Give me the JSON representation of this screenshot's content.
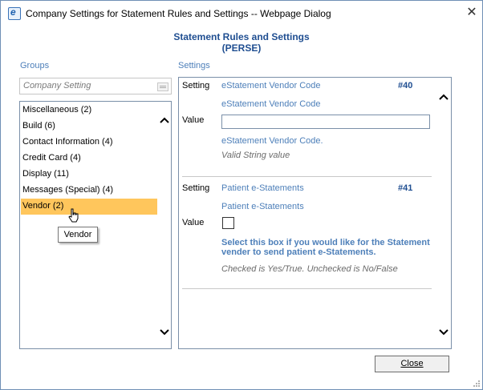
{
  "window": {
    "title": "Company Settings for Statement Rules and Settings -- Webpage Dialog",
    "icon": "ie-icon",
    "close_glyph": "✕"
  },
  "heading": {
    "title": "Statement Rules and Settings",
    "subtitle": "(PERSE)"
  },
  "groups": {
    "label": "Groups",
    "search_placeholder": "Company Setting",
    "items": [
      {
        "label": "Miscellaneous (2)",
        "selected": false
      },
      {
        "label": "Build (6)",
        "selected": false
      },
      {
        "label": "Contact Information (4)",
        "selected": false
      },
      {
        "label": "Credit Card (4)",
        "selected": false
      },
      {
        "label": "Display (11)",
        "selected": false
      },
      {
        "label": "Messages (Special) (4)",
        "selected": false
      },
      {
        "label": "Vendor (2)",
        "selected": true
      }
    ],
    "tooltip": "Vendor",
    "scroll_up": "❮",
    "scroll_down": "❯"
  },
  "settings": {
    "label": "Settings",
    "entries": [
      {
        "setting_label": "Setting",
        "name": "eStatement Vendor Code",
        "number": "#40",
        "title": "eStatement Vendor Code",
        "value_label": "Value",
        "value": "",
        "description": "eStatement Vendor Code.",
        "note": "Valid String value"
      },
      {
        "setting_label": "Setting",
        "name": "Patient e-Statements",
        "number": "#41",
        "title": "Patient e-Statements",
        "value_label": "Value",
        "checked": false,
        "description": "Select this box if you would like for the Statement vender to send patient e-Statements.",
        "note": "Checked is Yes/True. Unchecked is No/False"
      }
    ]
  },
  "footer": {
    "close_label": "Close"
  },
  "colors": {
    "accent": "#4d7fb9",
    "heading": "#1f4e91",
    "selected": "#ffc65c"
  }
}
